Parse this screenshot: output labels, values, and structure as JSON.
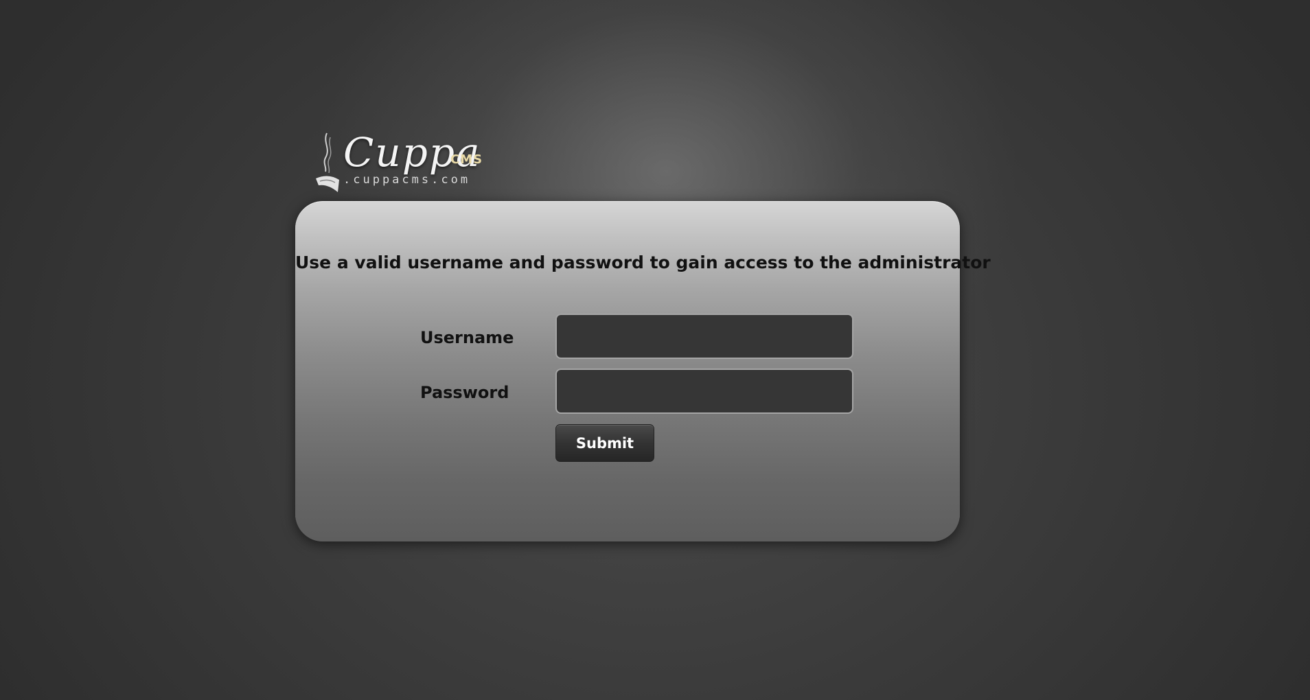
{
  "logo": {
    "brand": "Cuppa",
    "suffix": "CMS",
    "domain": ".cuppacms.com"
  },
  "login": {
    "message": "Use a valid username and password to gain access to the administrator",
    "username_label": "Username",
    "username_value": "",
    "password_label": "Password",
    "password_value": "",
    "submit_label": "Submit"
  },
  "colors": {
    "background": "#3a3a3a",
    "panel_top": "#d6d6d6",
    "panel_bottom": "#5e5e5e",
    "input_bg": "#363636",
    "logo_accent": "#e8d9a6"
  },
  "icons": {
    "logo_mark": "steaming-cup-icon"
  }
}
